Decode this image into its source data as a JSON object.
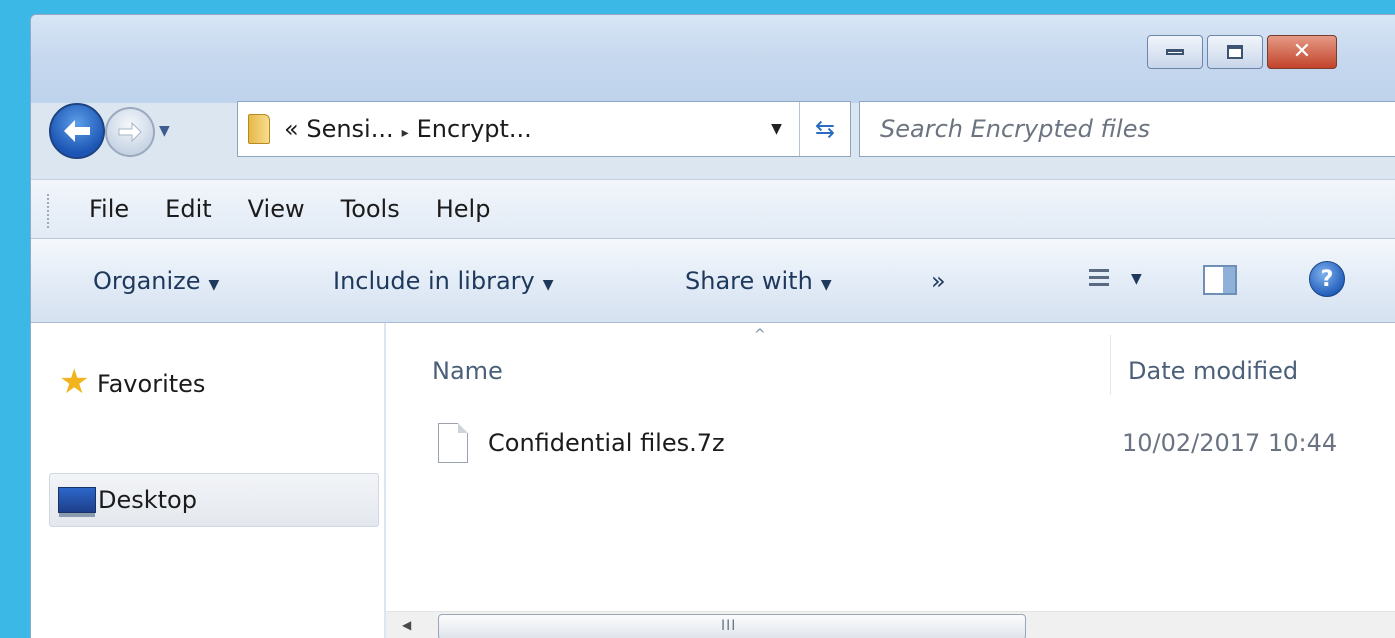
{
  "window": {
    "controls": {
      "close_glyph": "✕"
    }
  },
  "nav": {
    "back_glyph": "←",
    "forward_glyph": "→",
    "history_caret": "▼"
  },
  "address": {
    "crumb_overflow": "«",
    "crumbs": [
      "Sensi...",
      "Encrypt..."
    ],
    "separator": "▸",
    "dropdown": "▼",
    "refresh_glyph": "⇆"
  },
  "search": {
    "placeholder": "Search Encrypted files",
    "icon_glyph": "⚲"
  },
  "menu": {
    "items": [
      "File",
      "Edit",
      "View",
      "Tools",
      "Help"
    ]
  },
  "commands": {
    "organize": "Organize",
    "include_in_library": "Include in library",
    "share_with": "Share with",
    "more": "»",
    "caret": "▼",
    "help_glyph": "?"
  },
  "navpane": {
    "favorites": "Favorites",
    "desktop": "Desktop"
  },
  "filelist": {
    "sort_indicator": "^",
    "columns": {
      "name": "Name",
      "date_modified": "Date modified"
    },
    "rows": [
      {
        "name": "Confidential files.7z",
        "date_modified": "10/02/2017 10:44"
      }
    ]
  },
  "scrollbar": {
    "left_arrow": "◀",
    "right_arrow": "▶",
    "grip": "III"
  },
  "colors": {
    "desktop_background": "#3cb8e6",
    "accent_blue": "#1f5bb8",
    "close_red": "#c2432a"
  }
}
